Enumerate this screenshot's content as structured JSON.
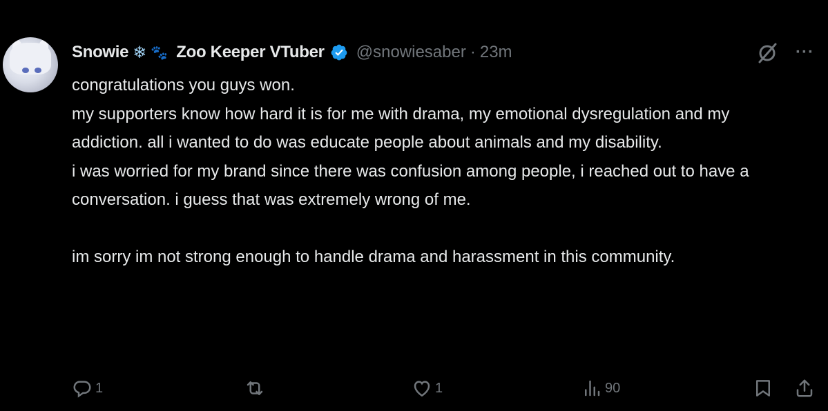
{
  "author": {
    "display_name": "Snowie",
    "display_name_suffix": "Zoo Keeper VTuber",
    "emoji_1": "❄",
    "emoji_2": "🐾",
    "handle": "@snowiesaber",
    "separator": "·",
    "time": "23m",
    "verified": true
  },
  "post": {
    "paragraphs": [
      "congratulations you guys won.",
      "my supporters know how hard it is for me with drama, my emotional dysregulation and my addiction. all i wanted to do was educate people about animals and my disability.",
      "i was worried for my brand since there was confusion among people, i reached out to have a conversation. i guess that was extremely wrong of me.",
      "",
      "im sorry im not strong enough to handle drama and harassment in this community."
    ]
  },
  "actions": {
    "reply_count": "1",
    "repost_count": "",
    "like_count": "1",
    "views_count": "90"
  },
  "icons": {
    "header": [
      "grok-icon",
      "more-icon"
    ],
    "actions": [
      "reply-icon",
      "repost-icon",
      "like-icon",
      "views-icon",
      "bookmark-icon",
      "share-icon"
    ]
  },
  "colors": {
    "background": "#000000",
    "text": "#e7e9ea",
    "muted": "#71767b",
    "verified": "#1d9bf0"
  }
}
